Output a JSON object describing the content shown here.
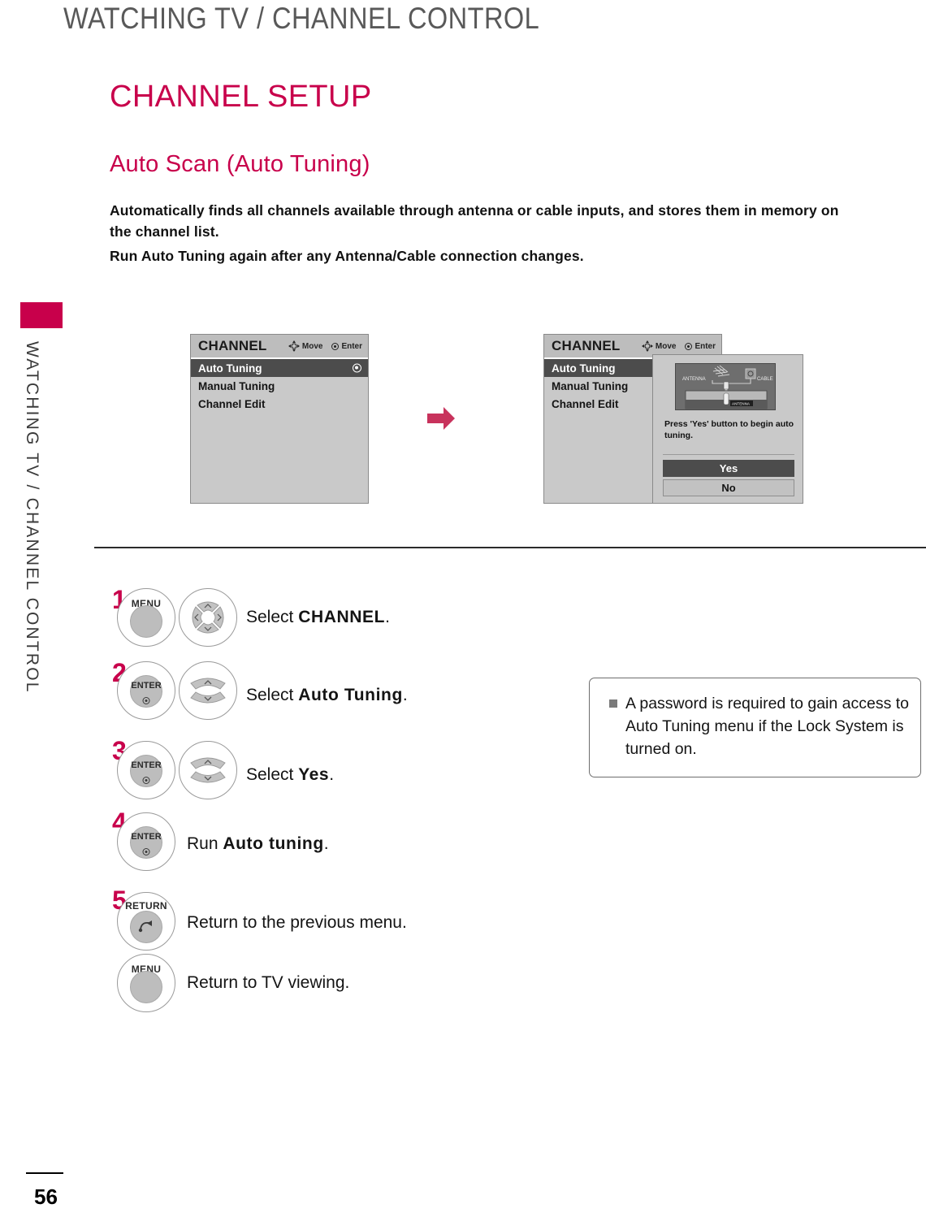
{
  "running_head": "WATCHING TV / CHANNEL CONTROL",
  "side_tab_label": "WATCHING TV / CHANNEL CONTROL",
  "headings": {
    "h1": "CHANNEL SETUP",
    "h2": "Auto Scan (Auto Tuning)"
  },
  "intro": {
    "para1": "Automatically finds all channels available through antenna or cable inputs, and stores them in memory on the channel list.",
    "para2": "Run Auto Tuning again after any Antenna/Cable connection changes."
  },
  "osd": {
    "title": "CHANNEL",
    "hints": [
      {
        "icon": "dpad-move-icon",
        "label": "Move"
      },
      {
        "icon": "enter-dot-icon",
        "label": "Enter"
      }
    ],
    "items": [
      {
        "label": "Auto Tuning",
        "selected": true,
        "mark": "radio-selected-icon"
      },
      {
        "label": "Manual Tuning",
        "selected": false,
        "mark": ""
      },
      {
        "label": "Channel Edit",
        "selected": false,
        "mark": ""
      }
    ]
  },
  "dialog": {
    "image_labels": {
      "antenna": "ANTENNA",
      "cable": "CABLE",
      "port": "ANTENNA"
    },
    "message": "Press 'Yes' button to begin auto tuning.",
    "buttons": [
      {
        "label": "Yes",
        "selected": true
      },
      {
        "label": "No",
        "selected": false
      }
    ]
  },
  "flow_arrow_icon": "right-arrow-icon",
  "steps": [
    {
      "number": "1",
      "keys": [
        {
          "type": "button",
          "label": "MENU",
          "icon": "menu-button-icon"
        },
        {
          "type": "dpad",
          "label": "",
          "icon": "dpad-4way-icon"
        }
      ],
      "text_prefix": "Select ",
      "text_bold": "CHANNEL",
      "text_suffix": "."
    },
    {
      "number": "2",
      "keys": [
        {
          "type": "enter",
          "label": "ENTER",
          "icon": "enter-button-icon"
        },
        {
          "type": "updown",
          "label": "",
          "icon": "up-down-arrows-icon"
        }
      ],
      "text_prefix": "Select ",
      "text_bold": "Auto Tuning",
      "text_suffix": "."
    },
    {
      "number": "3",
      "keys": [
        {
          "type": "enter",
          "label": "ENTER",
          "icon": "enter-button-icon"
        },
        {
          "type": "updown",
          "label": "",
          "icon": "up-down-arrows-icon"
        }
      ],
      "text_prefix": "Select ",
      "text_bold": "Yes",
      "text_suffix": "."
    },
    {
      "number": "4",
      "keys": [
        {
          "type": "enter",
          "label": "ENTER",
          "icon": "enter-button-icon"
        }
      ],
      "text_prefix": "Run ",
      "text_bold": "Auto tuning",
      "text_suffix": "."
    },
    {
      "number": "5",
      "keys": [
        {
          "type": "return",
          "label": "RETURN",
          "icon": "return-button-icon"
        }
      ],
      "text_prefix": "Return to the previous menu.",
      "text_bold": "",
      "text_suffix": ""
    },
    {
      "number": "",
      "keys": [
        {
          "type": "button",
          "label": "MENU",
          "icon": "menu-button-icon"
        }
      ],
      "text_prefix": "Return to TV viewing.",
      "text_bold": "",
      "text_suffix": ""
    }
  ],
  "note": {
    "bullet_icon": "square-bullet-icon",
    "text": "A password is required to gain access to Auto Tuning menu if the Lock System is turned on."
  },
  "footer": {
    "page_number": "56"
  },
  "colors": {
    "brand_magenta": "#c8004b",
    "osd_bg": "#c9c9c9",
    "osd_selected": "#4c4c4c",
    "head_gray": "#595959"
  }
}
